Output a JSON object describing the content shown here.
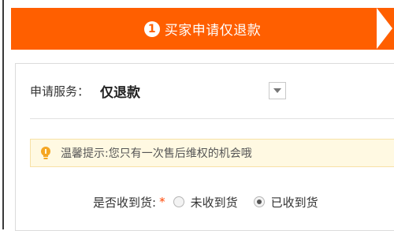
{
  "step": {
    "number": "1",
    "title": "买家申请仅退款"
  },
  "service": {
    "label": "申请服务：",
    "value": "仅退款"
  },
  "tip": {
    "text": "温馨提示:您只有一次售后维权的机会哦"
  },
  "receipt": {
    "label": "是否收到货:",
    "required_mark": "*",
    "options": [
      {
        "label": "未收到货",
        "selected": false
      },
      {
        "label": "已收到货",
        "selected": true
      }
    ]
  },
  "colors": {
    "accent": "#ff5f00",
    "tip_bg": "#fff9e2",
    "required": "#ff4400"
  },
  "icons": {
    "dropdown": "chevron-down-icon",
    "tip": "lightbulb-icon"
  }
}
